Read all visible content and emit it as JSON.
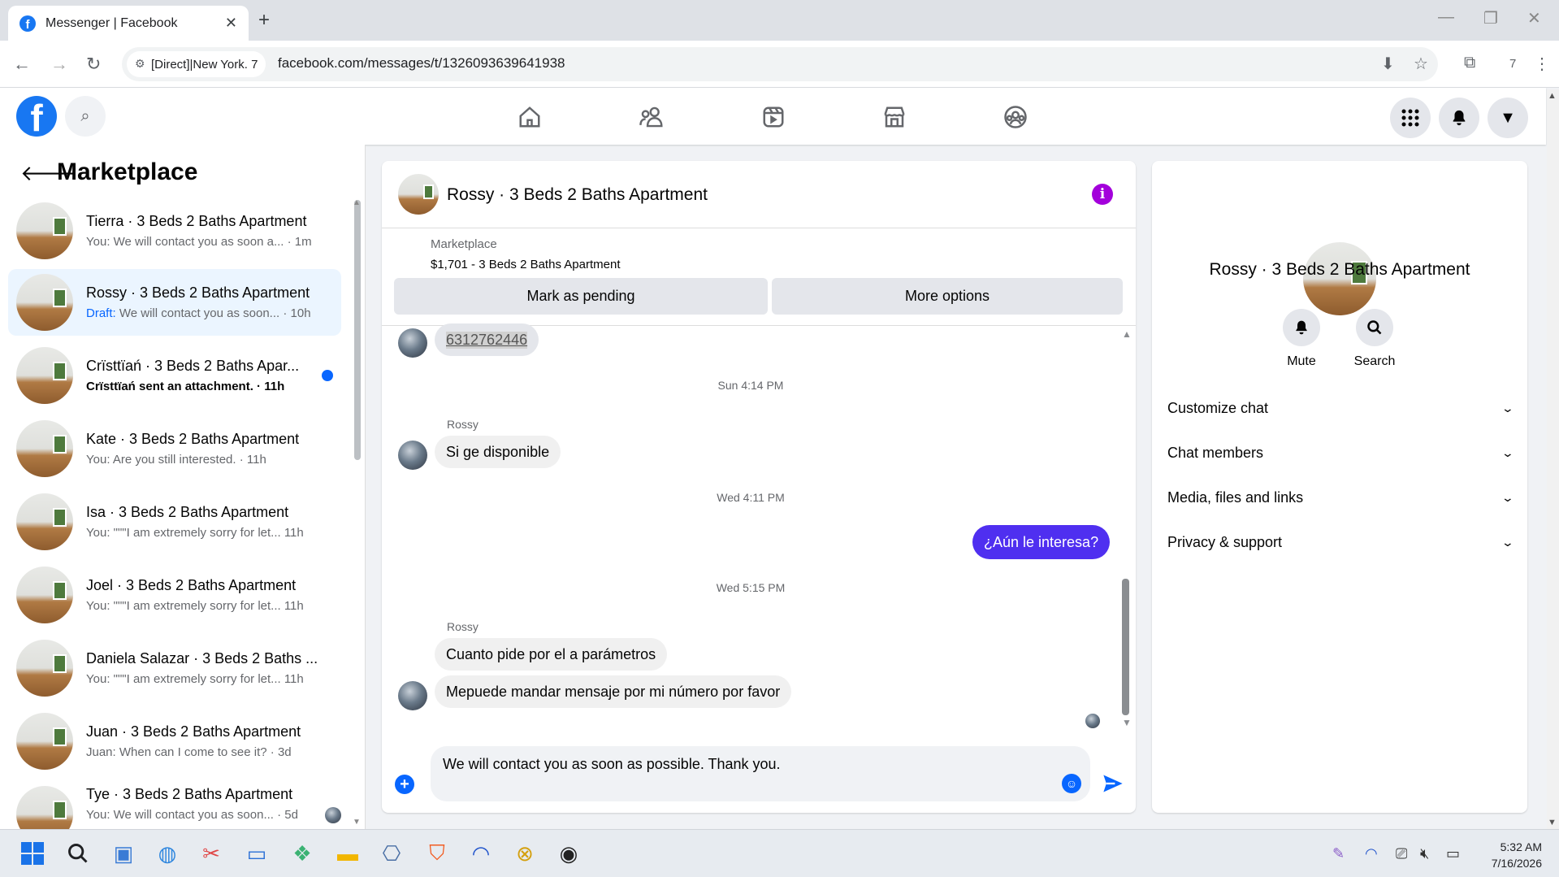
{
  "browser": {
    "tab_title": "Messenger | Facebook",
    "tab_favicon": "f",
    "site_chip": "[Direct]|New York. 7",
    "url": "facebook.com/messages/t/1326093639641938",
    "ext_count": "7"
  },
  "facebook": {
    "logo_letter": "f"
  },
  "sidebar": {
    "title": "Marketplace",
    "conversations": [
      {
        "name": "Tierra · 3 Beds 2 Baths Apartment",
        "preview": "You: We will contact you as soon a... · 1m"
      },
      {
        "name": "Rossy · 3 Beds 2 Baths Apartment",
        "draft": "Draft:",
        "preview": "We will contact you as soon... · 10h"
      },
      {
        "name": "Crïsttïań · 3 Beds 2 Baths Apar...",
        "preview": "Crïsttïań sent an attachment. · 11h"
      },
      {
        "name": "Kate · 3 Beds 2 Baths Apartment",
        "preview": "You: Are you still interested. · 11h"
      },
      {
        "name": "Isa · 3 Beds 2 Baths Apartment",
        "preview": "You: \"\"\"I am extremely sorry for let... 11h"
      },
      {
        "name": "Joel · 3 Beds 2 Baths Apartment",
        "preview": "You: \"\"\"I am extremely sorry for let... 11h"
      },
      {
        "name": "Daniela Salazar · 3 Beds 2 Baths ...",
        "preview": "You: \"\"\"I am extremely sorry for let... 11h"
      },
      {
        "name": "Juan · 3 Beds 2 Baths Apartment",
        "preview": "Juan: When can I come to see it? · 3d"
      },
      {
        "name": "Tye · 3 Beds 2 Baths Apartment",
        "preview": "You: We will contact you as soon... · 5d"
      }
    ]
  },
  "chat": {
    "title": "Rossy · 3 Beds 2 Baths Apartment",
    "listing_label": "Marketplace",
    "listing_price": "$1,701 - 3 Beds 2 Baths Apartment",
    "mark_pending": "Mark as pending",
    "more_options": "More options",
    "messages": {
      "m1": "6312762446",
      "ts1": "Sun 4:14 PM",
      "sender1": "Rossy",
      "m2": "Si ge disponible",
      "ts2": "Wed 4:11 PM",
      "out1": "¿Aún le interesa?",
      "ts3": "Wed 5:15 PM",
      "sender2": "Rossy",
      "m3": "Cuanto pide por el a parámetros",
      "m4": "Mepuede mandar mensaje por mi número por favor"
    },
    "composer_text": "We will contact you as soon as possible. Thank you.",
    "colors": {
      "outgoing": "#4f2ff0",
      "accent": "#0866ff",
      "info": "#a300db"
    }
  },
  "details": {
    "title": "Rossy · 3 Beds 2 Baths Apartment",
    "mute": "Mute",
    "search": "Search",
    "sections": [
      "Customize chat",
      "Chat members",
      "Media, files and links",
      "Privacy & support"
    ]
  },
  "taskbar": {
    "time": "5:32 AM",
    "date": "7/16/2026"
  }
}
